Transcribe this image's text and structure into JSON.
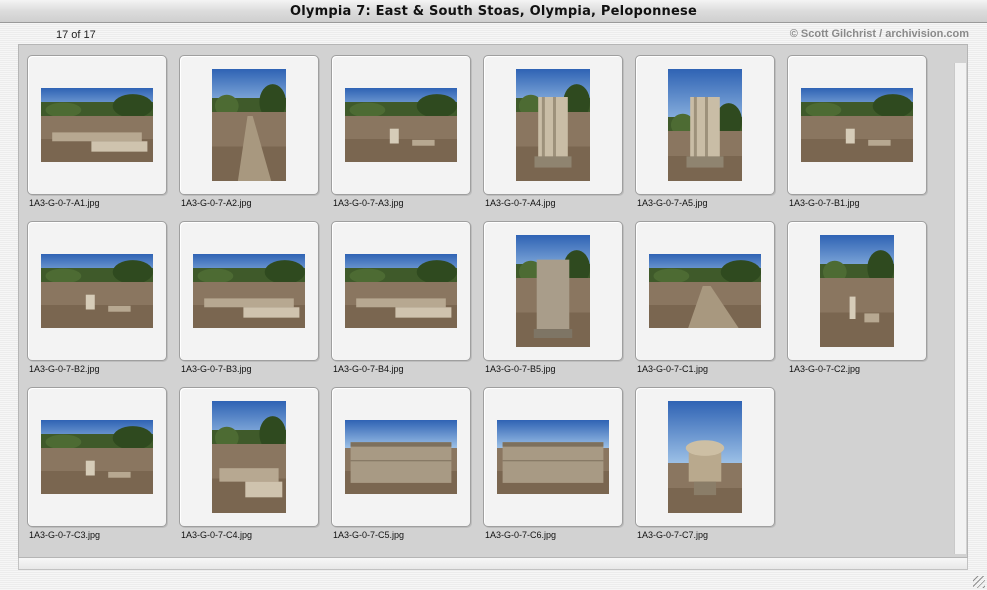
{
  "window": {
    "title": "Olympia 7: East & South Stoas, Olympia, Peloponnese",
    "counter": "17 of 17",
    "copyright": "© Scott Gilchrist / archivision.com"
  },
  "thumbnails": [
    {
      "filename": "1A3-G-0-7-A1.jpg",
      "orientation": "landscape",
      "scene": "stone-foundations"
    },
    {
      "filename": "1A3-G-0-7-A2.jpg",
      "orientation": "portrait",
      "scene": "stone-path"
    },
    {
      "filename": "1A3-G-0-7-A3.jpg",
      "orientation": "landscape",
      "scene": "grove-ruins"
    },
    {
      "filename": "1A3-G-0-7-A4.jpg",
      "orientation": "portrait",
      "scene": "column-drum"
    },
    {
      "filename": "1A3-G-0-7-A5.jpg",
      "orientation": "portrait",
      "scene": "ionic-column"
    },
    {
      "filename": "1A3-G-0-7-B1.jpg",
      "orientation": "landscape",
      "scene": "grove-ruins"
    },
    {
      "filename": "1A3-G-0-7-B2.jpg",
      "orientation": "landscape",
      "scene": "grove-ruins"
    },
    {
      "filename": "1A3-G-0-7-B3.jpg",
      "orientation": "landscape",
      "scene": "stone-foundations"
    },
    {
      "filename": "1A3-G-0-7-B4.jpg",
      "orientation": "landscape",
      "scene": "stone-foundations"
    },
    {
      "filename": "1A3-G-0-7-B5.jpg",
      "orientation": "portrait",
      "scene": "stele"
    },
    {
      "filename": "1A3-G-0-7-C1.jpg",
      "orientation": "landscape",
      "scene": "stone-path"
    },
    {
      "filename": "1A3-G-0-7-C2.jpg",
      "orientation": "portrait",
      "scene": "grove-ruins"
    },
    {
      "filename": "1A3-G-0-7-C3.jpg",
      "orientation": "landscape",
      "scene": "grove-ruins"
    },
    {
      "filename": "1A3-G-0-7-C4.jpg",
      "orientation": "portrait",
      "scene": "stone-foundations"
    },
    {
      "filename": "1A3-G-0-7-C5.jpg",
      "orientation": "landscape",
      "scene": "stone-wall"
    },
    {
      "filename": "1A3-G-0-7-C6.jpg",
      "orientation": "landscape",
      "scene": "stone-wall"
    },
    {
      "filename": "1A3-G-0-7-C7.jpg",
      "orientation": "portrait",
      "scene": "capital"
    }
  ],
  "colors": {
    "sky": "#4a82c8",
    "foliage": "#3f5a2a",
    "stone": "#b7a891",
    "ground": "#8a7660"
  }
}
